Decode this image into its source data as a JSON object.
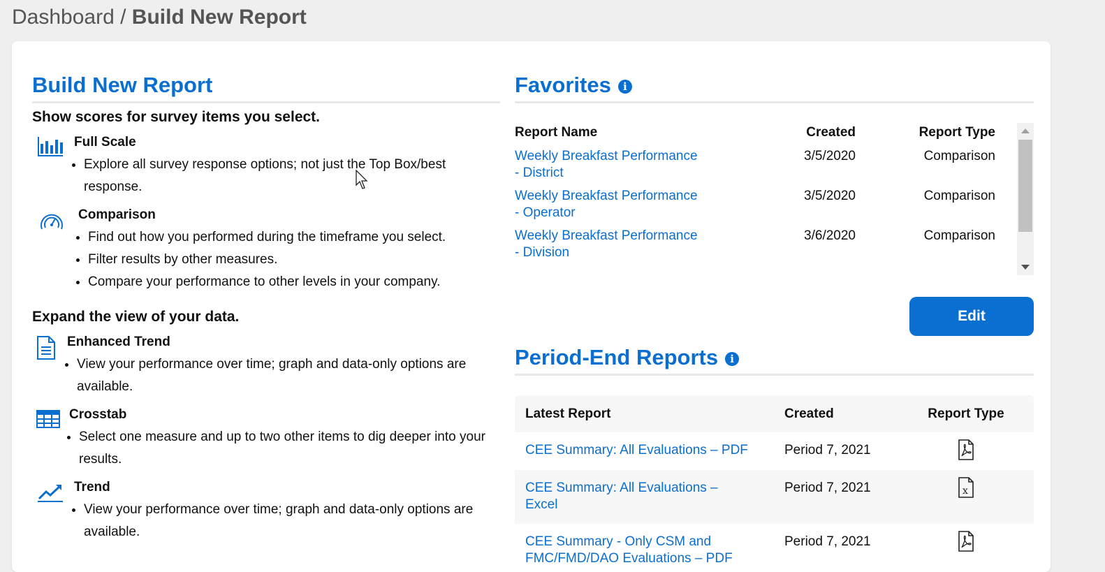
{
  "breadcrumb": {
    "parent": "Dashboard",
    "separator": " / ",
    "current": "Build New Report"
  },
  "build": {
    "title": "Build New Report",
    "section1_heading": "Show scores for survey items you select.",
    "items1": [
      {
        "name": "Full Scale",
        "icon": "bar-chart-icon",
        "bullets": [
          "Explore all survey response options; not just the Top Box/best response."
        ]
      },
      {
        "name": "Comparison",
        "icon": "gauge-icon",
        "bullets": [
          "Find out how you performed during the timeframe you select.",
          "Filter results by other measures.",
          "Compare your performance to other levels in your company."
        ]
      }
    ],
    "section2_heading": "Expand the view of your data.",
    "items2": [
      {
        "name": "Enhanced Trend",
        "icon": "document-icon",
        "bullets": [
          "View your performance over time; graph and data-only options are available."
        ]
      },
      {
        "name": "Crosstab",
        "icon": "table-grid-icon",
        "bullets": [
          "Select one measure and up to two other items to dig deeper into your results."
        ]
      },
      {
        "name": "Trend",
        "icon": "trend-line-icon",
        "bullets": [
          "View your performance over time; graph and data-only options are available."
        ]
      }
    ]
  },
  "favorites": {
    "title": "Favorites",
    "columns": [
      "Report Name",
      "Created",
      "Report Type"
    ],
    "rows": [
      {
        "name_line1": "Weekly Breakfast Performance",
        "name_line2": "- District",
        "created": "3/5/2020",
        "type": "Comparison"
      },
      {
        "name_line1": "Weekly Breakfast Performance",
        "name_line2": "- Operator",
        "created": "3/5/2020",
        "type": "Comparison"
      },
      {
        "name_line1": "Weekly Breakfast Performance",
        "name_line2": "- Division",
        "created": "3/6/2020",
        "type": "Comparison"
      }
    ],
    "edit_label": "Edit"
  },
  "period_end": {
    "title": "Period-End Reports",
    "columns": [
      "Latest Report",
      "Created",
      "Report Type"
    ],
    "rows": [
      {
        "name": "CEE Summary: All Evaluations – PDF",
        "created": "Period 7, 2021",
        "file_icon": "pdf-file-icon"
      },
      {
        "name": "CEE Summary: All Evaluations – Excel",
        "created": "Period 7, 2021",
        "file_icon": "excel-file-icon"
      },
      {
        "name": "CEE Summary - Only CSM and FMC/FMD/DAO Evaluations – PDF",
        "created": "Period 7, 2021",
        "file_icon": "pdf-file-icon"
      }
    ]
  },
  "colors": {
    "accent": "#0a6fd0",
    "background": "#efefef",
    "card": "#ffffff"
  }
}
